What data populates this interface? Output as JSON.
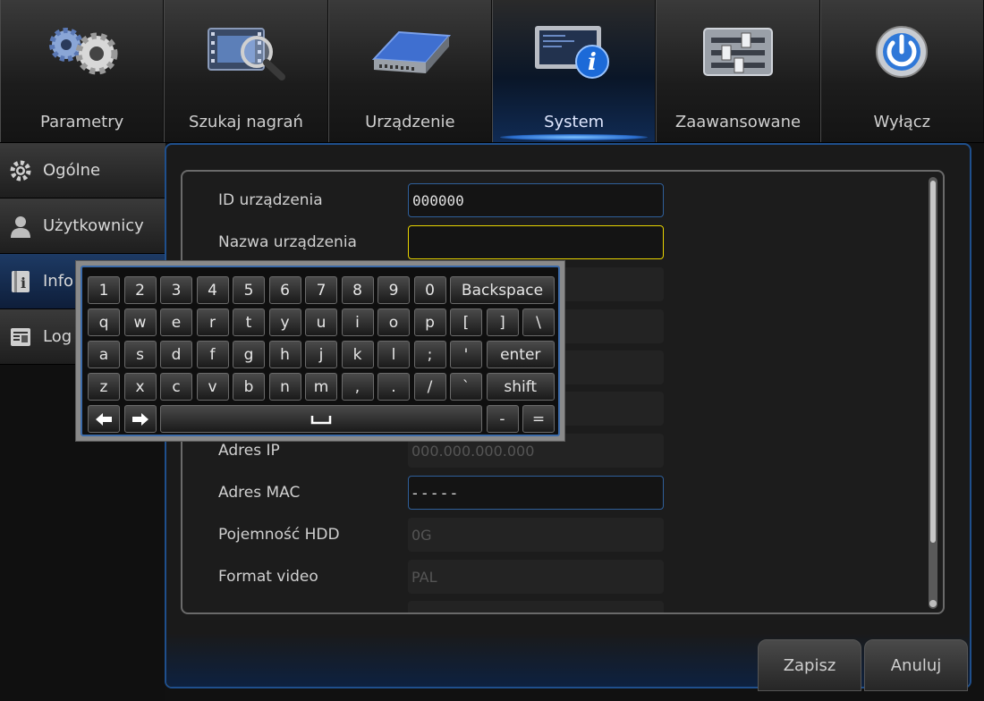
{
  "tabs": [
    {
      "label": "Parametry",
      "icon": "gears-icon"
    },
    {
      "label": "Szukaj nagrań",
      "icon": "film-search-icon"
    },
    {
      "label": "Urządzenie",
      "icon": "hard-drive-icon"
    },
    {
      "label": "System",
      "icon": "monitor-info-icon",
      "active": true
    },
    {
      "label": "Zaawansowane",
      "icon": "sliders-icon"
    },
    {
      "label": "Wyłącz",
      "icon": "power-icon"
    }
  ],
  "sidebar": {
    "items": [
      {
        "label": "Ogólne",
        "icon": "gear-icon"
      },
      {
        "label": "Użytkownicy",
        "icon": "user-icon"
      },
      {
        "label": "Info",
        "icon": "info-book-icon",
        "active": true
      },
      {
        "label": "Log",
        "icon": "log-icon"
      }
    ]
  },
  "form": {
    "device_id": {
      "label": "ID urządzenia",
      "value": "000000"
    },
    "device_name": {
      "label": "Nazwa urządzenia",
      "value": ""
    },
    "ip": {
      "label": "Adres IP",
      "value": "000.000.000.000"
    },
    "mac": {
      "label": "Adres MAC",
      "value": "- - - - -"
    },
    "hdd": {
      "label": "Pojemność HDD",
      "value": "0G"
    },
    "video": {
      "label": "Format video",
      "value": "PAL"
    }
  },
  "buttons": {
    "save": "Zapisz",
    "cancel": "Anuluj"
  },
  "keyboard": {
    "row1": [
      "1",
      "2",
      "3",
      "4",
      "5",
      "6",
      "7",
      "8",
      "9",
      "0"
    ],
    "backspace": "Backspace",
    "row2": [
      "q",
      "w",
      "e",
      "r",
      "t",
      "y",
      "u",
      "i",
      "o",
      "p",
      "[",
      "]",
      "\\"
    ],
    "row3": [
      "a",
      "s",
      "d",
      "f",
      "g",
      "h",
      "j",
      "k",
      "l",
      ";",
      "'"
    ],
    "enter": "enter",
    "row4": [
      "z",
      "x",
      "c",
      "v",
      "b",
      "n",
      "m",
      ",",
      ".",
      "/",
      "`"
    ],
    "shift": "shift",
    "minus": "-",
    "equals": "="
  },
  "colors": {
    "accent": "#1f4f8c",
    "focus": "#e8d400"
  }
}
